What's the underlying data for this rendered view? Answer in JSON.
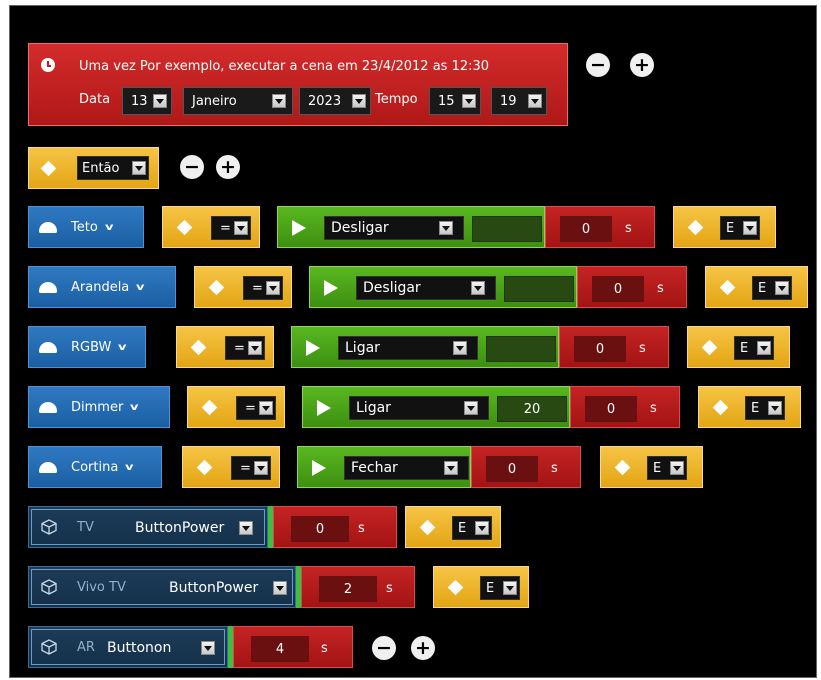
{
  "schedule": {
    "title": "Uma vez Por exemplo, executar a cena em 23/4/2012 as 12:30",
    "date_label": "Data",
    "day": "13",
    "month": "Janeiro",
    "year": "2023",
    "time_label": "Tempo",
    "hour": "15",
    "minute": "19"
  },
  "then_block": {
    "label": "Então"
  },
  "operator_default": "=",
  "connector_default": "E",
  "seconds_unit": "s",
  "devices": [
    {
      "name": "Teto",
      "action": "Desligar",
      "value": "",
      "delay": "0",
      "connector": "E"
    },
    {
      "name": "Arandela",
      "action": "Desligar",
      "value": "",
      "delay": "0",
      "connector": "E"
    },
    {
      "name": "RGBW",
      "action": "Ligar",
      "value": "",
      "delay": "0",
      "connector": "E"
    },
    {
      "name": "Dimmer",
      "action": "Ligar",
      "value": "20",
      "delay": "0",
      "connector": "E"
    },
    {
      "name": "Cortina",
      "action": "Fechar",
      "delay": "0",
      "connector": "E"
    }
  ],
  "ir_devices": [
    {
      "name": "TV",
      "command": "ButtonPower",
      "delay": "0",
      "connector": "E"
    },
    {
      "name": "Vivo TV",
      "command": "ButtonPower",
      "delay": "2",
      "connector": "E"
    },
    {
      "name": "AR",
      "command": "Buttonon",
      "delay": "4"
    }
  ],
  "icons": {
    "schedule": "clock-icon",
    "remove": "minus-circle-icon",
    "add": "plus-circle-icon",
    "condition": "diamond-icon",
    "device": "lamp-icon",
    "action": "play-icon",
    "ir": "ir-cube-icon"
  },
  "colors": {
    "background": "#000000",
    "schedule_red": "#c41f1f",
    "condition_yellow": "#eeb42a",
    "device_blue": "#2469b0",
    "action_green": "#4ba318",
    "delay_red": "#b41a1a",
    "ir_navy": "#183650"
  }
}
